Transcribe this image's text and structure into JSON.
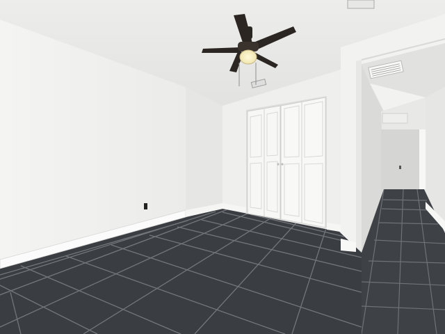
{
  "scene": {
    "subject": "empty-bedroom",
    "colors": {
      "ceiling": "#e9e9e7",
      "left_wall": "#f1f1ef",
      "back_wall": "#eeeeec",
      "floor_tile": "#3a3d42",
      "grout": "#6f7276",
      "baseboard": "#fafafa",
      "fan_blade": "#2b2622",
      "closet_door": "#f7f7f5",
      "hallway_wall": "#e4e4e2"
    }
  }
}
